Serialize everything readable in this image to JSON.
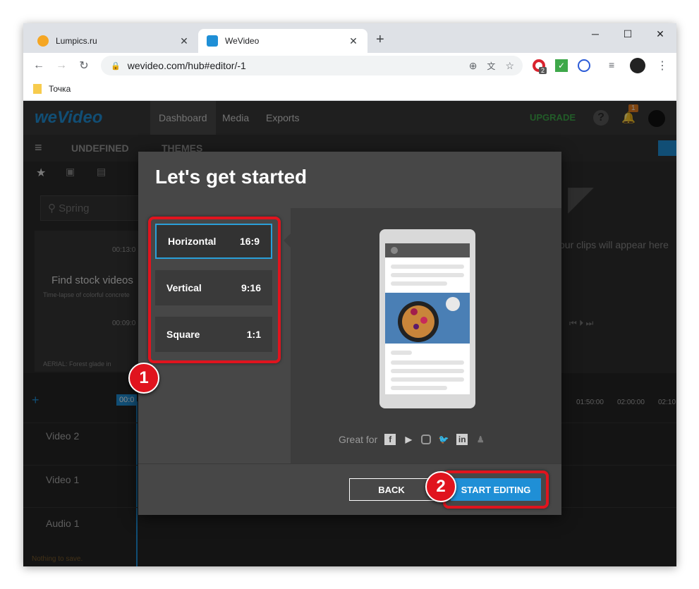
{
  "browser": {
    "tabs": [
      {
        "title": "Lumpics.ru",
        "active": false
      },
      {
        "title": "WeVideo",
        "active": true
      }
    ],
    "url": "wevideo.com/hub#editor/-1",
    "bookmark": "Точка",
    "extension_badge": "2"
  },
  "app": {
    "logo": "weVideo",
    "nav": [
      "Dashboard",
      "Media",
      "Exports"
    ],
    "upgrade": "UPGRADE",
    "notification_count": "1",
    "project_name": "UNDEFINED",
    "themes": "THEMES",
    "search_placeholder": "Spring",
    "stock_text": "Find stock videos",
    "clip_caption_1": "Time-lapse of colorful concrete",
    "clip_caption_2": "AERIAL: Forest glade in",
    "clip_time_1": "00:13:0",
    "clip_time_2": "00:09:0",
    "preview_hint": "our clips will appear here",
    "timeline_marks": [
      "01:50:00",
      "02:00:00",
      "02:10"
    ],
    "playhead_time": "00:0",
    "tracks": [
      "Video 2",
      "Video 1",
      "Audio 1"
    ],
    "status": "Nothing to save."
  },
  "modal": {
    "title": "Let's get started",
    "options": [
      {
        "label": "Horizontal",
        "ratio": "16:9",
        "selected": true
      },
      {
        "label": "Vertical",
        "ratio": "9:16",
        "selected": false
      },
      {
        "label": "Square",
        "ratio": "1:1",
        "selected": false
      }
    ],
    "great_for": "Great for",
    "social_icons": [
      "facebook-icon",
      "youtube-icon",
      "instagram-icon",
      "twitter-icon",
      "linkedin-icon",
      "snapchat-icon"
    ],
    "back_label": "BACK",
    "start_label": "START EDITING"
  },
  "annotations": [
    "1",
    "2"
  ],
  "colors": {
    "accent": "#1f8fd6",
    "highlight": "#e0141e",
    "upgrade": "#3ea84a"
  }
}
